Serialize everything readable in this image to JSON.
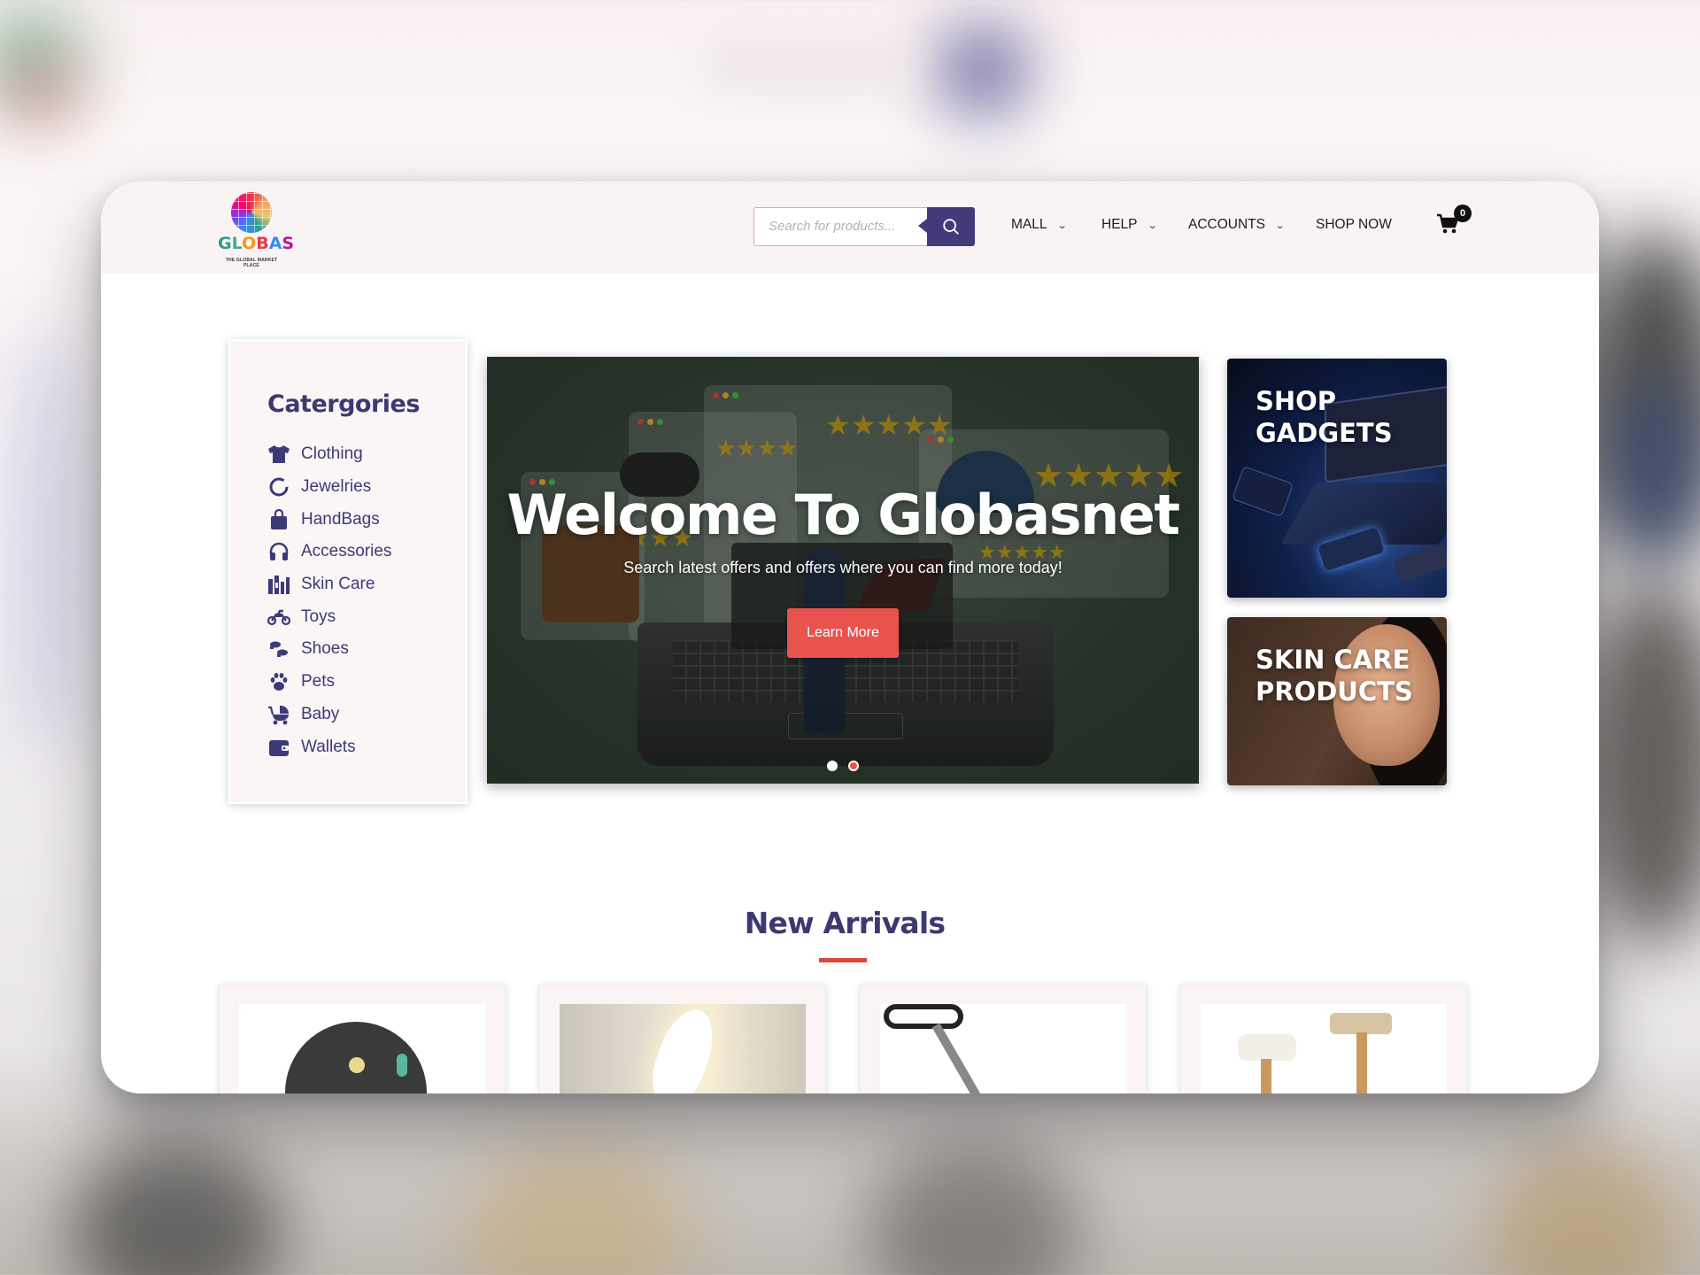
{
  "header": {
    "logo_text": "GLOBAS",
    "logo_tagline": "THE GLOBAL MARKET PLACE",
    "search_placeholder": "Search for products...",
    "nav": [
      {
        "label": "MALL",
        "has_dropdown": true
      },
      {
        "label": "HELP",
        "has_dropdown": true
      },
      {
        "label": "ACCOUNTS",
        "has_dropdown": true
      },
      {
        "label": "SHOP NOW",
        "has_dropdown": false
      }
    ],
    "cart_count": "0"
  },
  "categories": {
    "title": "Catergories",
    "items": [
      {
        "label": "Clothing",
        "icon": "shirt-icon"
      },
      {
        "label": "Jewelries",
        "icon": "ring-icon"
      },
      {
        "label": "HandBags",
        "icon": "handbag-icon"
      },
      {
        "label": "Accessories",
        "icon": "headphones-icon"
      },
      {
        "label": "Skin Care",
        "icon": "skincare-icon"
      },
      {
        "label": "Toys",
        "icon": "motorcycle-icon"
      },
      {
        "label": "Shoes",
        "icon": "shoes-icon"
      },
      {
        "label": "Pets",
        "icon": "paw-icon"
      },
      {
        "label": "Baby",
        "icon": "stroller-icon"
      },
      {
        "label": "Wallets",
        "icon": "wallet-icon"
      }
    ]
  },
  "hero": {
    "title": "Welcome To Globasnet",
    "subtitle": "Search latest offers and offers where you can find more today!",
    "button_label": "Learn More",
    "slides": 2,
    "active_slide": 2
  },
  "promos": [
    {
      "title": "SHOP GADGETS"
    },
    {
      "title": "SKIN CARE PRODUCTS"
    }
  ],
  "new_arrivals": {
    "title": "New Arrivals"
  },
  "colors": {
    "brand_purple": "#3d3970",
    "accent_red": "#e8534e",
    "header_bg": "#faf3f4"
  }
}
